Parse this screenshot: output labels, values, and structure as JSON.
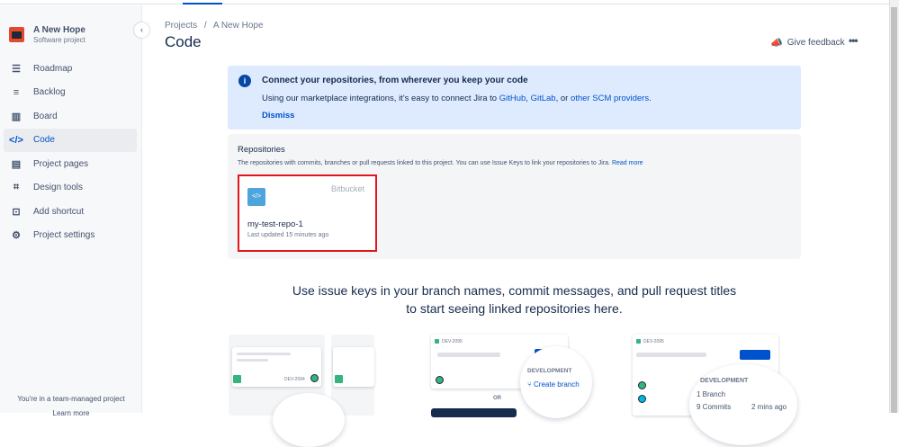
{
  "sidebar": {
    "project_name": "A New Hope",
    "project_type": "Software project",
    "items": [
      {
        "label": "Roadmap",
        "icon": "roadmap-icon"
      },
      {
        "label": "Backlog",
        "icon": "backlog-icon"
      },
      {
        "label": "Board",
        "icon": "board-icon"
      },
      {
        "label": "Code",
        "icon": "code-icon",
        "active": true
      },
      {
        "label": "Project pages",
        "icon": "pages-icon"
      },
      {
        "label": "Design tools",
        "icon": "design-icon"
      },
      {
        "label": "Add shortcut",
        "icon": "add-shortcut-icon"
      },
      {
        "label": "Project settings",
        "icon": "gear-icon"
      }
    ],
    "footer_text": "You're in a team-managed project",
    "footer_link": "Learn more"
  },
  "header": {
    "breadcrumb_root": "Projects",
    "breadcrumb_sep": "/",
    "breadcrumb_project": "A New Hope",
    "title": "Code",
    "feedback": "Give feedback",
    "more": "•••"
  },
  "banner": {
    "title": "Connect your repositories, from wherever you keep your code",
    "text_pre": "Using our marketplace integrations, it's easy to connect Jira to ",
    "github": "GitHub",
    "comma": ", ",
    "gitlab": "GitLab",
    "or": ", or ",
    "other": "other SCM providers",
    "period": ".",
    "dismiss": "Dismiss"
  },
  "repositories": {
    "title": "Repositories",
    "desc": "The repositories with commits, branches or pull requests linked to this project. You can use Issue Keys to link your repositories to Jira.",
    "read_more": "Read more",
    "items": [
      {
        "name": "my-test-repo-1",
        "source": "Bitbucket",
        "updated": "Last updated 15 minutes ago"
      }
    ]
  },
  "empty": {
    "line1": "Use issue keys in your branch names, commit messages, and pull request titles",
    "line2": "to start seeing linked repositories here."
  },
  "illustration": {
    "key1": "DEV-2094",
    "key2": "DEV-2095",
    "key3": "DEV-2095",
    "development": "DEVELOPMENT",
    "create_branch": "Create branch",
    "or": "OR",
    "development2": "DEVELOPMENT",
    "branch": "1 Branch",
    "commits": "9 Commits",
    "time": "2 mins ago"
  }
}
